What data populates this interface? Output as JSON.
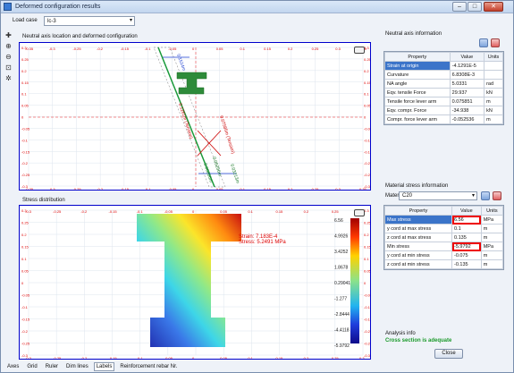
{
  "window": {
    "title": "Deformed configuration results",
    "btn_min": "–",
    "btn_max": "□",
    "btn_close": "✕"
  },
  "loadcase": {
    "label": "Load case",
    "value": "lc-3"
  },
  "plot1": {
    "title": "Neutral axis location and deformed configuration",
    "ticks_y": [
      "0.3",
      "0.25",
      "0.2",
      "0.15",
      "0.1",
      "0.05",
      "0",
      "-0.05",
      "-0.1",
      "-0.15",
      "-0.2",
      "-0.25",
      "-0.3"
    ],
    "ticks_x": [
      "-0.35",
      "-0.3",
      "-0.25",
      "-0.2",
      "-0.15",
      "-0.1",
      "-0.05",
      "0",
      "0.05",
      "0.1",
      "0.15",
      "0.2",
      "0.25",
      "0.3",
      "0.35"
    ],
    "annotations": {
      "dim1": "0.1514m",
      "dim2": "0.1261m (Tension)",
      "dim3": "0.07585m (Tension)",
      "dim4": "0.00806m",
      "dim5": "0.05256m",
      "dim6": "0.03213m"
    }
  },
  "plot2": {
    "title": "Stress distribution",
    "ticks_y": [
      "0.3",
      "0.25",
      "0.2",
      "0.15",
      "0.1",
      "0.05",
      "0",
      "-0.05",
      "-0.1",
      "-0.15",
      "-0.2",
      "-0.25",
      "-0.3"
    ],
    "ticks_x": [
      "-0.3",
      "-0.25",
      "-0.2",
      "-0.15",
      "-0.1",
      "-0.05",
      "0",
      "0.05",
      "0.1",
      "0.15",
      "0.2",
      "0.25",
      "0.3"
    ],
    "tooltip_strain": "Strain: 7.183E-4",
    "tooltip_stress": "Stress: 5.2491 MPa",
    "scale": [
      "6.56",
      "4.9926",
      "3.4252",
      "1.8678",
      "0.29041",
      "-1.277",
      "-2.8444",
      "-4.4118",
      "-5.9792"
    ]
  },
  "statusbar": {
    "tabs": [
      "Axes",
      "Grid",
      "Ruler",
      "Dim lines",
      "Labels",
      "Reinforcement rebar Nr."
    ]
  },
  "neutral": {
    "group_label": "Neutral axis information",
    "headers": [
      "Property",
      "Value",
      "Units"
    ],
    "rows": [
      {
        "p": "Strain at origin",
        "v": "-4.1291E-5",
        "u": ""
      },
      {
        "p": "Curvature",
        "v": "6.8308E-3",
        "u": ""
      },
      {
        "p": "NA angle",
        "v": "5.0331",
        "u": "rad"
      },
      {
        "p": "Eqv. tensile Force",
        "v": "29.937",
        "u": "kN"
      },
      {
        "p": "Tensile force lever arm",
        "v": "0.075851",
        "u": "m"
      },
      {
        "p": "Eqv. compr. Force",
        "v": "-34.938",
        "u": "kN"
      },
      {
        "p": "Compr. force lever arm",
        "v": "-0.052536",
        "u": "m"
      }
    ]
  },
  "material": {
    "group_label": "Material stress information",
    "label": "Material",
    "value": "C20",
    "headers": [
      "Property",
      "Value",
      "Units"
    ],
    "rows": [
      {
        "p": "Max stress",
        "v": "6.56",
        "u": "MPa"
      },
      {
        "p": "y cord at max stress",
        "v": "0.1",
        "u": "m"
      },
      {
        "p": "z cord at max stress",
        "v": "0.135",
        "u": "m"
      },
      {
        "p": "Min stress",
        "v": "-5.9792",
        "u": "MPa"
      },
      {
        "p": "y cord at min stress",
        "v": "-0.075",
        "u": "m"
      },
      {
        "p": "z cord at min stress",
        "v": "-0.135",
        "u": "m"
      }
    ]
  },
  "analysis": {
    "label": "Analysis info",
    "message": "Cross section is adequate"
  },
  "close_label": "Close"
}
